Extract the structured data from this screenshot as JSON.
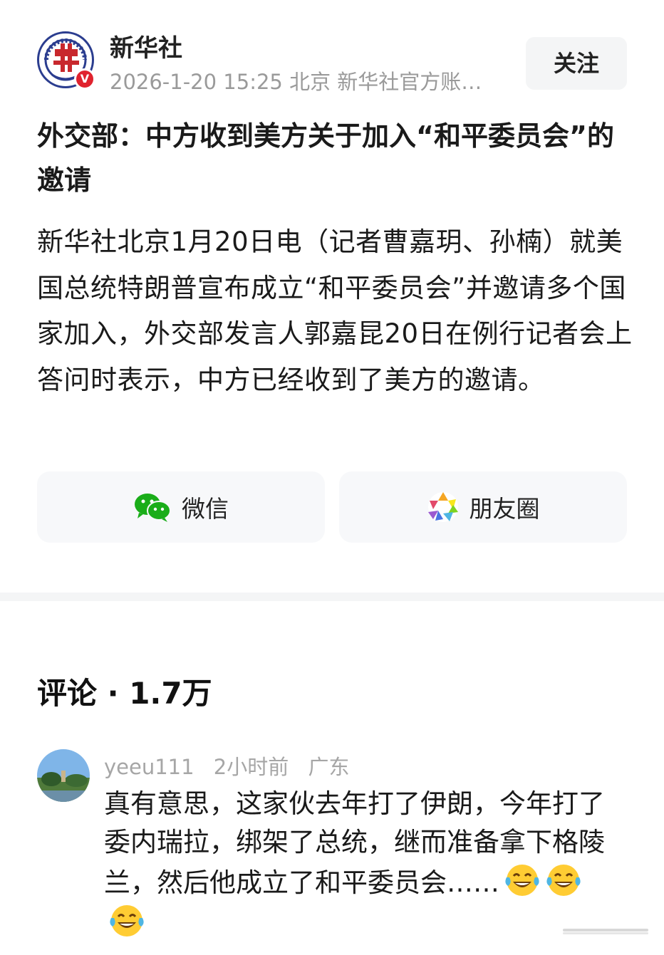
{
  "header": {
    "author": "新华社",
    "avatar_badge": "V",
    "meta": "2026-1-20  15:25  北京  新华社官方账…",
    "follow_label": "关注"
  },
  "article": {
    "title": "外交部：中方收到美方关于加入“和平委员会”的邀请",
    "body": "新华社北京1月20日电（记者曹嘉玥、孙楠）就美国总统特朗普宣布成立“和平委员会”并邀请多个国家加入，外交部发言人郭嘉昆20日在例行记者会上答问时表示，中方已经收到了美方的邀请。"
  },
  "share": {
    "wechat_label": "微信",
    "moments_label": "朋友圈",
    "wechat_icon": "wechat-icon",
    "moments_icon": "moments-icon",
    "wechat_color": "#1aad19"
  },
  "comments": {
    "title": "评论 · 1.7万",
    "items": [
      {
        "user": "yeeu111",
        "time": "2小时前",
        "location": "广东",
        "text": "真有意思，这家伙去年打了伊朗，今年打了委内瑞拉，绑架了总统，继而准备拿下格陵兰，然后他成立了和平委员会……",
        "emojis": [
          "laughing-tears-emoji",
          "laughing-tears-emoji",
          "laughing-tears-emoji"
        ]
      }
    ]
  },
  "colors": {
    "badge_red": "#e0232e",
    "logo_blue": "#2b3d8f",
    "meta_gray": "#9a9a9a"
  }
}
